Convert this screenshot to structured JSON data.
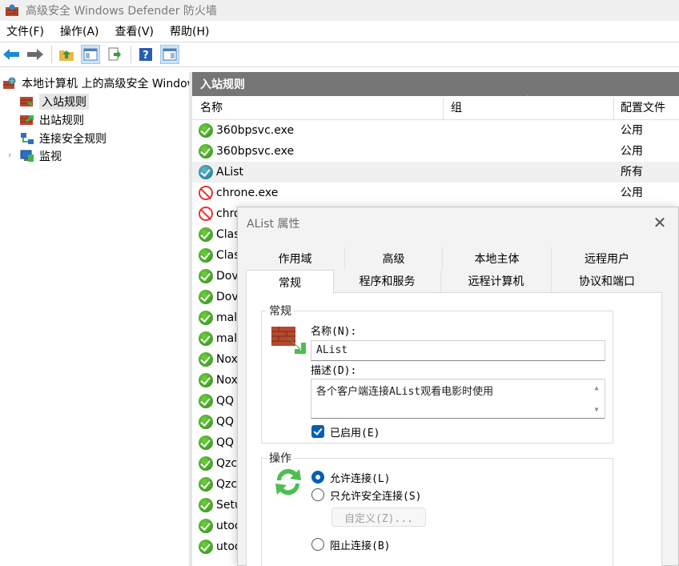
{
  "window": {
    "title": "高级安全 Windows Defender 防火墙"
  },
  "menu": {
    "items": [
      "文件(F)",
      "操作(A)",
      "查看(V)",
      "帮助(H)"
    ]
  },
  "toolbar": {
    "icons": [
      "back-arrow-icon",
      "forward-arrow-icon",
      "folder-up-icon",
      "show-hide-tree-icon",
      "export-list-icon",
      "help-icon",
      "show-hide-action-pane-icon"
    ]
  },
  "tree": {
    "root": "本地计算机 上的高级安全 Windows Defender 防火墙",
    "items": [
      "入站规则",
      "出站规则",
      "连接安全规则",
      "监视"
    ],
    "selected": "入站规则"
  },
  "pane": {
    "header": "入站规则",
    "columns": {
      "name": "名称",
      "group": "组",
      "profile": "配置文件"
    },
    "rows": [
      {
        "name": "360bpsvc.exe",
        "profile": "公用",
        "status": "allow"
      },
      {
        "name": "360bpsvc.exe",
        "profile": "公用",
        "status": "allow"
      },
      {
        "name": "AList",
        "profile": "所有",
        "status": "allow-highlighted"
      },
      {
        "name": "chrone.exe",
        "profile": "公用",
        "status": "block"
      },
      {
        "name": "chro",
        "profile": "",
        "status": "block"
      },
      {
        "name": "Clas",
        "profile": "",
        "status": "allow"
      },
      {
        "name": "Clas",
        "profile": "",
        "status": "allow"
      },
      {
        "name": "Dov",
        "profile": "",
        "status": "allow"
      },
      {
        "name": "Dov",
        "profile": "",
        "status": "allow"
      },
      {
        "name": "mal",
        "profile": "",
        "status": "allow"
      },
      {
        "name": "mal",
        "profile": "",
        "status": "allow"
      },
      {
        "name": "Nox",
        "profile": "",
        "status": "allow"
      },
      {
        "name": "Nox",
        "profile": "",
        "status": "allow"
      },
      {
        "name": "QQ",
        "profile": "",
        "status": "allow"
      },
      {
        "name": "QQ",
        "profile": "",
        "status": "allow"
      },
      {
        "name": "QQ",
        "profile": "",
        "status": "allow"
      },
      {
        "name": "Qzc",
        "profile": "",
        "status": "allow"
      },
      {
        "name": "Qzc",
        "profile": "",
        "status": "allow"
      },
      {
        "name": "Setu",
        "profile": "",
        "status": "allow"
      },
      {
        "name": "utoo",
        "profile": "",
        "status": "allow"
      },
      {
        "name": "utoo",
        "profile": "",
        "status": "allow"
      }
    ]
  },
  "dialog": {
    "title": "AList 属性",
    "close": "✕",
    "tabs_row1": [
      "作用域",
      "高级",
      "本地主体",
      "远程用户"
    ],
    "tabs_row2": [
      "常规",
      "程序和服务",
      "远程计算机",
      "协议和端口"
    ],
    "active_tab": "常规",
    "general": {
      "group_label": "常规",
      "name_label": "名称(N):",
      "name_value": "AList",
      "desc_label": "描述(D):",
      "desc_value": "各个客户端连接AList观看电影时使用",
      "enabled_label": "已启用(E)",
      "enabled": true
    },
    "action": {
      "group_label": "操作",
      "allow_label": "允许连接(L)",
      "allow_secure_label": "只允许安全连接(S)",
      "customize_label": "自定义(Z)...",
      "block_label": "阻止连接(B)",
      "selected": "allow"
    }
  }
}
